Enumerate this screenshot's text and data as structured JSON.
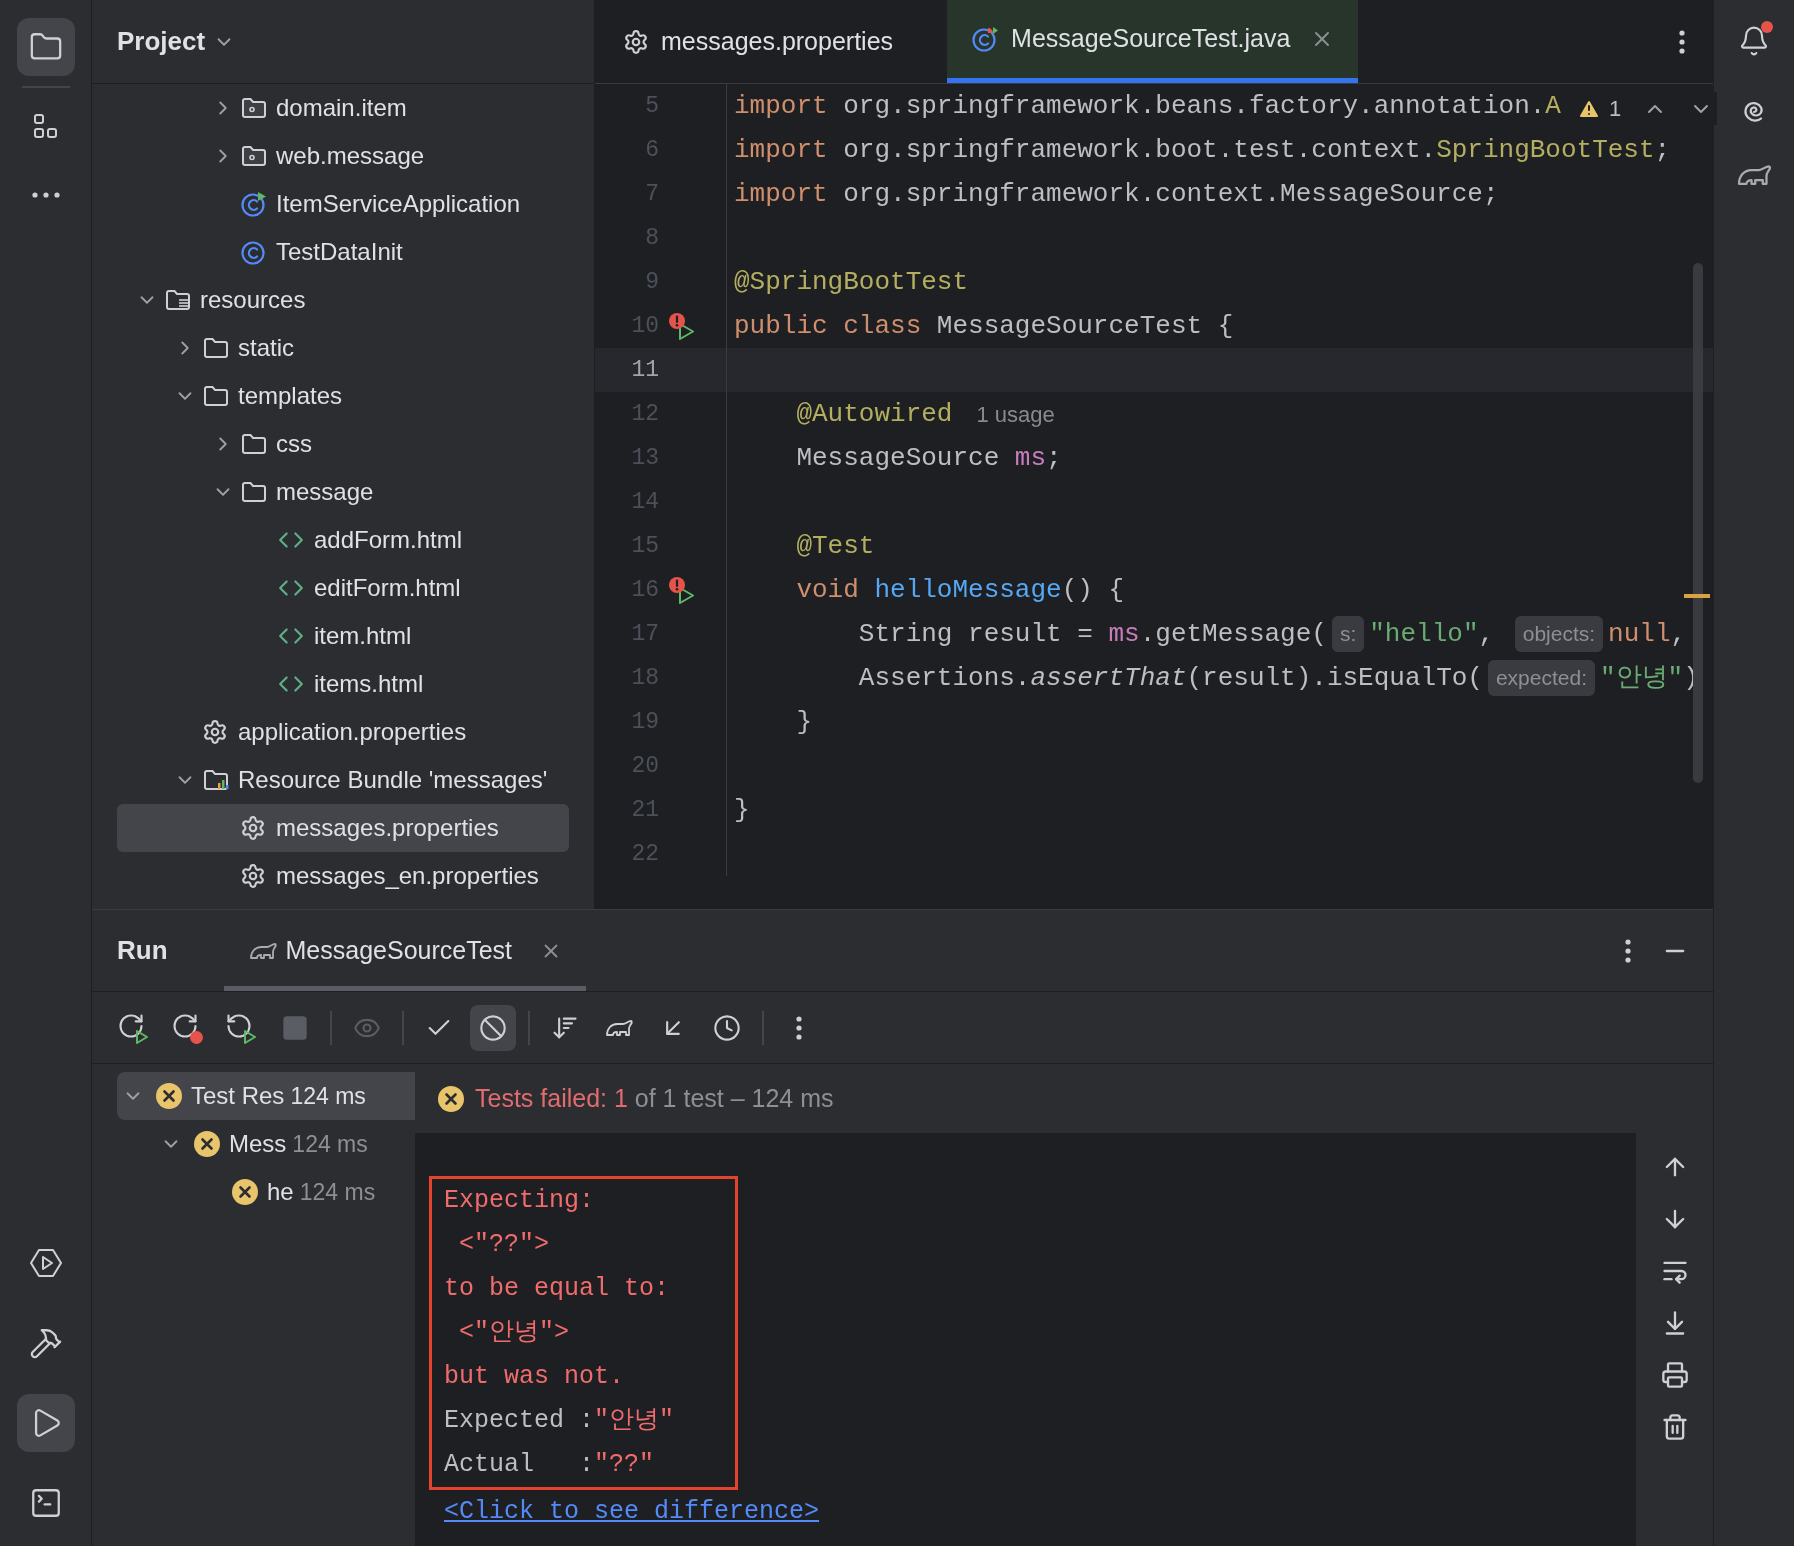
{
  "left_strip": {
    "top": [
      {
        "kind": "project",
        "selected": true
      },
      {
        "kind": "structure",
        "selected": false
      },
      {
        "kind": "more",
        "selected": false
      }
    ],
    "bottom": [
      {
        "kind": "services",
        "selected": false
      },
      {
        "kind": "build",
        "selected": false
      },
      {
        "kind": "run",
        "selected": true
      },
      {
        "kind": "terminal",
        "selected": false
      }
    ]
  },
  "project": {
    "title": "Project",
    "tree": [
      {
        "children": [
          {
            "children": [
              {
                "name": "domain.item",
                "kind": "package",
                "expanded": false,
                "selected": false
              },
              {
                "name": "web.message",
                "kind": "package",
                "expanded": false,
                "selected": false
              },
              {
                "name": "ItemServiceApplication",
                "kind": "spring_class",
                "selected": false
              },
              {
                "name": "TestDataInit",
                "kind": "class",
                "selected": false
              }
            ]
          }
        ]
      },
      {
        "name": "resources",
        "kind": "resources",
        "expanded": true,
        "selected": false,
        "children": [
          {
            "name": "static",
            "kind": "folder",
            "expanded": false,
            "selected": false
          },
          {
            "name": "templates",
            "kind": "folder",
            "expanded": true,
            "selected": false,
            "children": [
              {
                "name": "css",
                "kind": "folder",
                "expanded": false,
                "selected": false
              },
              {
                "name": "message",
                "kind": "folder",
                "expanded": true,
                "selected": false,
                "children": [
                  {
                    "name": "addForm.html",
                    "kind": "html",
                    "selected": false
                  },
                  {
                    "name": "editForm.html",
                    "kind": "html",
                    "selected": false
                  },
                  {
                    "name": "item.html",
                    "kind": "html",
                    "selected": false
                  },
                  {
                    "name": "items.html",
                    "kind": "html",
                    "selected": false
                  }
                ]
              }
            ]
          },
          {
            "name": "application.properties",
            "kind": "properties",
            "selected": false
          },
          {
            "name": "Resource Bundle 'messages'",
            "kind": "bundle",
            "expanded": true,
            "selected": false,
            "children": [
              {
                "name": "messages.properties",
                "kind": "properties",
                "selected": true
              },
              {
                "name": "messages_en.properties",
                "kind": "properties",
                "selected": false
              }
            ]
          }
        ]
      }
    ]
  },
  "editor": {
    "tabs": [
      {
        "label": "messages.properties",
        "kind": "properties",
        "selected": false
      },
      {
        "label": "MessageSourceTest.java",
        "kind": "test_class",
        "selected": true
      }
    ],
    "inspection": {
      "warnings": "1"
    },
    "lines": [
      {
        "number": "5",
        "current": false,
        "tokens": [
          {
            "kind": "keyword",
            "text": "import"
          },
          {
            "kind": "plain",
            "text": " org.springframework.beans.factory.annotation."
          },
          {
            "kind": "annotation",
            "text": "A"
          }
        ]
      },
      {
        "number": "6",
        "current": false,
        "tokens": [
          {
            "kind": "keyword",
            "text": "import"
          },
          {
            "kind": "plain",
            "text": " org.springframework.boot.test.context."
          },
          {
            "kind": "annotation",
            "text": "SpringBootTest"
          },
          {
            "kind": "plain",
            "text": ";"
          }
        ]
      },
      {
        "number": "7",
        "current": false,
        "tokens": [
          {
            "kind": "keyword",
            "text": "import"
          },
          {
            "kind": "plain",
            "text": " org.springframework.context.MessageSource;"
          }
        ]
      },
      {
        "number": "8",
        "current": false
      },
      {
        "number": "9",
        "current": false,
        "tokens": [
          {
            "kind": "annotation",
            "text": "@SpringBootTest"
          }
        ]
      },
      {
        "number": "10",
        "current": false,
        "gutter": {
          "kind": "run_failed"
        },
        "tokens": [
          {
            "kind": "keyword",
            "text": "public class"
          },
          {
            "kind": "plain",
            "text": " MessageSourceTest {"
          }
        ]
      },
      {
        "number": "11",
        "current": true
      },
      {
        "number": "12",
        "current": false,
        "tokens": [
          {
            "kind": "annotation",
            "text": "    @Autowired"
          },
          {
            "kind": "usage",
            "text": "1 usage"
          }
        ]
      },
      {
        "number": "13",
        "current": false,
        "tokens": [
          {
            "kind": "plain",
            "text": "    MessageSource "
          },
          {
            "kind": "field",
            "text": "ms"
          },
          {
            "kind": "plain",
            "text": ";"
          }
        ]
      },
      {
        "number": "14",
        "current": false
      },
      {
        "number": "15",
        "current": false,
        "tokens": [
          {
            "kind": "annotation",
            "text": "    @Test"
          }
        ]
      },
      {
        "number": "16",
        "current": false,
        "gutter": {
          "kind": "run_failed"
        },
        "tokens": [
          {
            "kind": "keyword",
            "text": "    void"
          },
          {
            "kind": "method_decl",
            "text": " helloMessage"
          },
          {
            "kind": "plain",
            "text": "() {"
          }
        ]
      },
      {
        "number": "17",
        "current": false,
        "tokens": [
          {
            "kind": "plain",
            "text": "        String result = "
          },
          {
            "kind": "field",
            "text": "ms"
          },
          {
            "kind": "plain",
            "text": ".getMessage("
          },
          {
            "kind": "hint",
            "text": "s:"
          },
          {
            "kind": "string",
            "text": "\"hello\""
          },
          {
            "kind": "plain",
            "text": ", "
          },
          {
            "kind": "hint",
            "text": "objects:"
          },
          {
            "kind": "keyword",
            "text": "null"
          },
          {
            "kind": "plain",
            "text": ","
          }
        ]
      },
      {
        "number": "18",
        "current": false,
        "tokens": [
          {
            "kind": "plain",
            "text": "        Assertions."
          },
          {
            "kind": "static_call",
            "text": "assertThat"
          },
          {
            "kind": "plain",
            "text": "(result).isEqualTo("
          },
          {
            "kind": "hint",
            "text": "expected:"
          },
          {
            "kind": "string",
            "text": "\"안녕\""
          },
          {
            "kind": "plain",
            "text": ")"
          }
        ]
      },
      {
        "number": "19",
        "current": false,
        "tokens": [
          {
            "kind": "plain",
            "text": "    }"
          }
        ]
      },
      {
        "number": "20",
        "current": false
      },
      {
        "number": "21",
        "current": false,
        "tokens": [
          {
            "kind": "plain",
            "text": "}"
          }
        ]
      },
      {
        "number": "22",
        "current": false
      }
    ]
  },
  "right_strip": [
    {
      "kind": "notifications",
      "unread": true
    },
    {
      "kind": "ai_assistant"
    },
    {
      "kind": "gradle"
    }
  ],
  "run": {
    "title": "Run",
    "tabs": [
      {
        "label": "MessageSourceTest",
        "kind": "gradle",
        "selected": true
      }
    ],
    "toolbar": [
      [
        {
          "kind": "rerun",
          "selected": false,
          "disabled": false
        },
        {
          "kind": "rerun_failed",
          "selected": false,
          "disabled": false
        },
        {
          "kind": "auto_test",
          "selected": false,
          "disabled": false
        },
        {
          "kind": "stop",
          "selected": false,
          "disabled": true
        }
      ],
      [
        {
          "kind": "preview",
          "selected": false,
          "disabled": true
        }
      ],
      [
        {
          "kind": "passed",
          "selected": false,
          "disabled": false
        },
        {
          "kind": "ignored",
          "selected": true,
          "disabled": false
        }
      ],
      [
        {
          "kind": "sort",
          "selected": false,
          "disabled": false
        },
        {
          "kind": "import",
          "selected": false,
          "disabled": false
        },
        {
          "kind": "collapse",
          "selected": false,
          "disabled": false
        },
        {
          "kind": "history",
          "selected": false,
          "disabled": false
        }
      ],
      [
        {
          "kind": "more",
          "selected": false,
          "disabled": false
        }
      ]
    ],
    "tree": [
      {
        "name": "Test Res",
        "time": "124 ms",
        "kind": "failed",
        "expanded": true,
        "selected": true,
        "children": [
          {
            "name": "Mess",
            "time": "124 ms",
            "kind": "failed",
            "expanded": true,
            "selected": false,
            "children": [
              {
                "name": "he",
                "time": "124 ms",
                "kind": "failed",
                "selected": false
              }
            ]
          }
        ]
      }
    ],
    "status": {
      "kind": "failed",
      "failed": "Tests failed: 1",
      "rest": "of 1 test – 124 ms"
    },
    "console": {
      "framed": [
        [
          {
            "kind": "error",
            "text": "Expecting:"
          }
        ],
        [
          {
            "kind": "error",
            "text": " <\"??\">"
          }
        ],
        [
          {
            "kind": "error",
            "text": "to be equal to:"
          }
        ],
        [
          {
            "kind": "error",
            "text": " <\"안녕\">"
          }
        ],
        [
          {
            "kind": "error",
            "text": "but was not."
          }
        ],
        [
          {
            "kind": "plain",
            "text": "Expected :"
          },
          {
            "kind": "error",
            "text": "\"안녕\""
          }
        ],
        [
          {
            "kind": "plain",
            "text": "Actual   :"
          },
          {
            "kind": "error",
            "text": "\"??\""
          }
        ]
      ],
      "link": "<Click to see difference>"
    }
  }
}
